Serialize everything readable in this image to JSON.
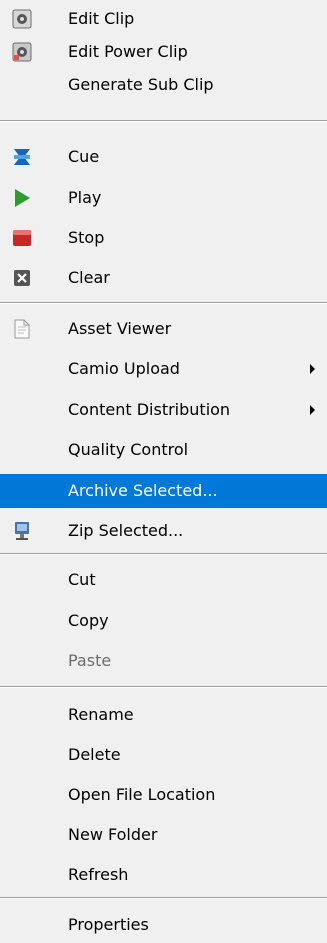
{
  "menu": {
    "edit_clip": "Edit Clip",
    "edit_power_clip": "Edit Power Clip",
    "generate_sub_clip": "Generate Sub Clip",
    "cue": "Cue",
    "play": "Play",
    "stop": "Stop",
    "clear": "Clear",
    "asset_viewer": "Asset Viewer",
    "camio_upload": "Camio Upload",
    "content_distribution": "Content Distribution",
    "quality_control": "Quality Control",
    "archive_selected": "Archive Selected...",
    "zip_selected": "Zip Selected...",
    "cut": "Cut",
    "copy": "Copy",
    "paste": "Paste",
    "rename": "Rename",
    "delete": "Delete",
    "open_file_location": "Open File Location",
    "new_folder": "New Folder",
    "refresh": "Refresh",
    "properties": "Properties"
  },
  "icons": {
    "edit_clip": "film-clip-icon",
    "edit_power_clip": "power-clip-icon",
    "cue": "cue-icon",
    "play": "play-icon",
    "stop": "stop-icon",
    "clear": "clear-icon",
    "asset_viewer": "document-icon",
    "zip_selected": "zip-icon"
  },
  "colors": {
    "highlight": "#0078d7",
    "play": "#2e9b2e",
    "stop": "#c62828",
    "cue": "#1565c0"
  },
  "state": {
    "highlighted_item": "Archive Selected...",
    "disabled_items": [
      "Paste"
    ]
  }
}
